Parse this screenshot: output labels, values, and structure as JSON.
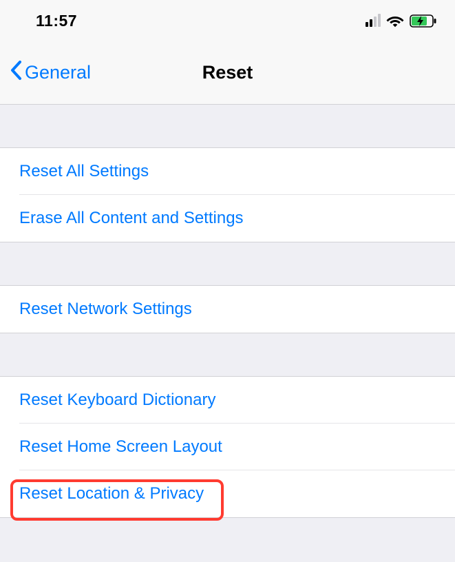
{
  "status": {
    "time": "11:57"
  },
  "nav": {
    "back_label": "General",
    "title": "Reset"
  },
  "sections": {
    "s1": {
      "reset_all_settings": "Reset All Settings",
      "erase_all": "Erase All Content and Settings"
    },
    "s2": {
      "reset_network": "Reset Network Settings"
    },
    "s3": {
      "reset_keyboard": "Reset Keyboard Dictionary",
      "reset_home": "Reset Home Screen Layout",
      "reset_location": "Reset Location & Privacy"
    }
  }
}
